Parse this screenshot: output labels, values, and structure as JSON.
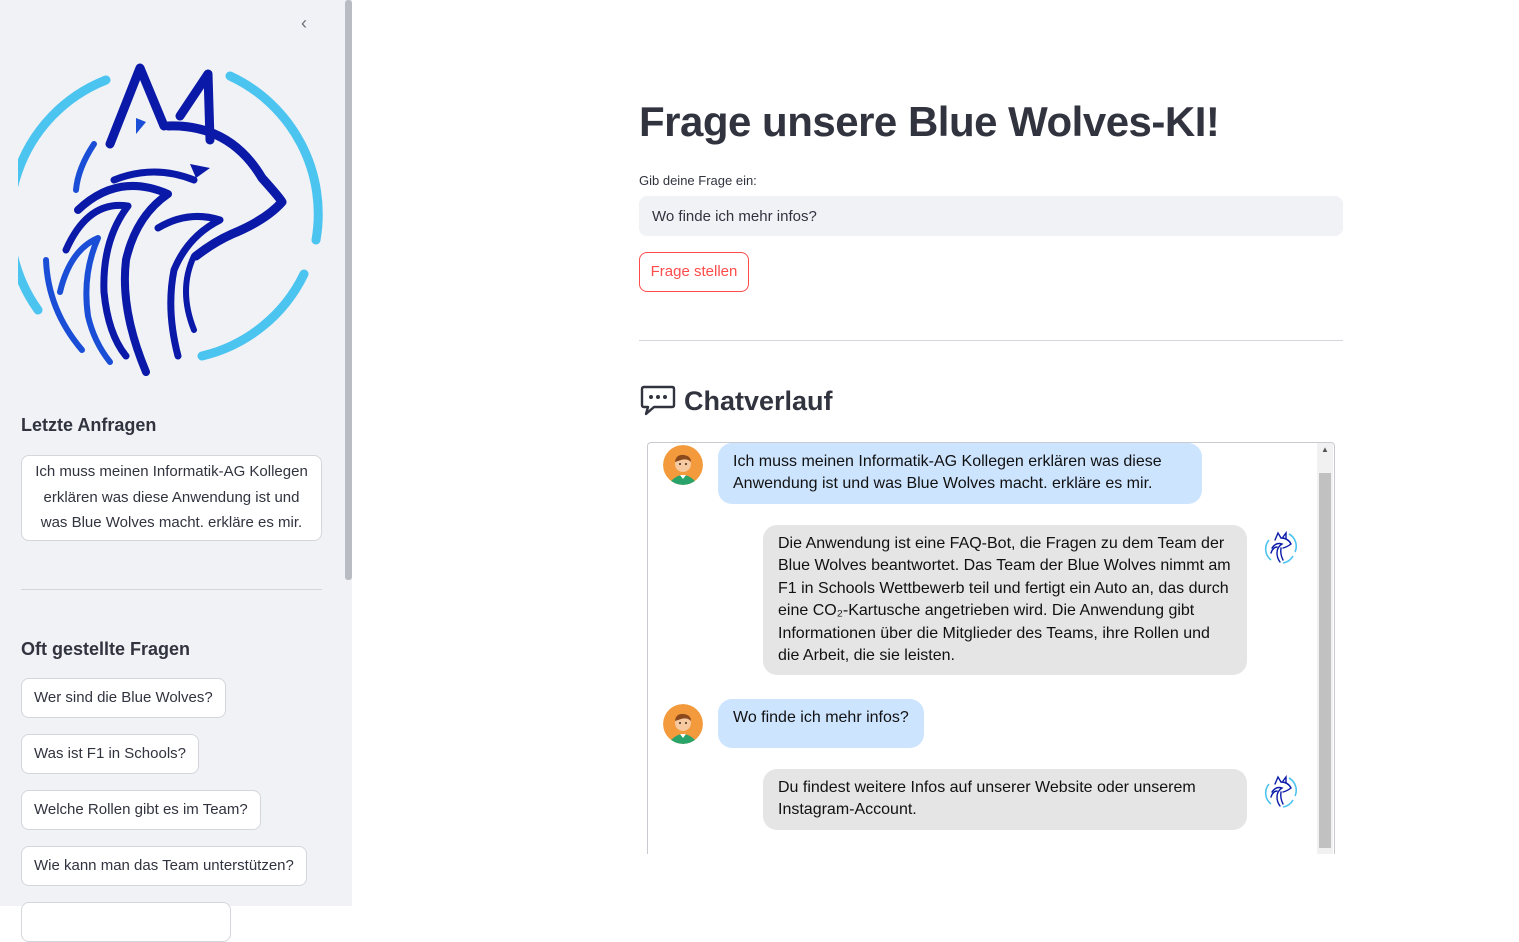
{
  "sidebar": {
    "collapse_icon": "chevron-left-icon",
    "logo": "blue-wolves-logo",
    "recent_heading": "Letzte Anfragen",
    "recent_items": [
      "Ich muss meinen Informatik-AG Kollegen erklären was diese Anwendung ist und was Blue Wolves macht. erkläre es mir."
    ],
    "faq_heading": "Oft gestellte Fragen",
    "faq_items": [
      "Wer sind die Blue Wolves?",
      "Was ist F1 in Schools?",
      "Welche Rollen gibt es im Team?",
      "Wie kann man das Team unterstützen?"
    ]
  },
  "main": {
    "title": "Frage unsere Blue Wolves-KI!",
    "input_label": "Gib deine Frage ein:",
    "input_value": "Wo finde ich mehr infos?",
    "ask_button": "Frage stellen",
    "chat_heading": "Chatverlauf",
    "chat_icon": "speech-balloon-icon"
  },
  "chat": {
    "messages": [
      {
        "role": "user",
        "avatar": "user-avatar-icon",
        "text": "Ich muss meinen Informatik-AG Kollegen erklären was diese Anwendung ist und was Blue Wolves macht. erkläre es mir."
      },
      {
        "role": "bot",
        "avatar": "wolf-avatar-icon",
        "text": "Die Anwendung ist eine FAQ-Bot, die Fragen zu dem Team der Blue Wolves beantwortet. Das Team der Blue Wolves nimmt am F1 in Schools Wettbewerb teil und fertigt ein Auto an, das durch eine CO₂-Kartusche angetrieben wird. Die Anwendung gibt Informationen über die Mitglieder des Teams, ihre Rollen und die Arbeit, die sie leisten."
      },
      {
        "role": "user",
        "avatar": "user-avatar-icon",
        "text": "Wo finde ich mehr infos?"
      },
      {
        "role": "bot",
        "avatar": "wolf-avatar-icon",
        "text": "Du findest weitere Infos auf unserer Website oder unserem Instagram-Account."
      }
    ]
  },
  "colors": {
    "sidebar_bg": "#f0f2f6",
    "accent": "#ff4b4b",
    "user_bubble": "#cde4ff",
    "bot_bubble": "#e5e5e5",
    "logo_dark_blue": "#0a19a8",
    "logo_light_blue": "#4cc4f0"
  }
}
